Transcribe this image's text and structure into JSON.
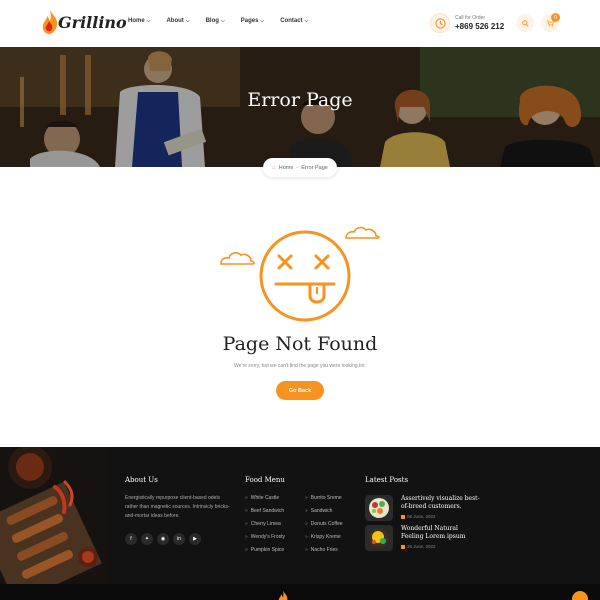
{
  "brand": {
    "name": "Grillino",
    "accent": "#f7931e"
  },
  "nav": [
    {
      "label": "Home"
    },
    {
      "label": "About"
    },
    {
      "label": "Blog"
    },
    {
      "label": "Pages"
    },
    {
      "label": "Contact"
    }
  ],
  "call": {
    "label": "Call for Order",
    "number": "+869 526 212"
  },
  "cart": {
    "count": "0"
  },
  "hero": {
    "title": "Error Page"
  },
  "breadcrumb": {
    "home": "Home",
    "current": "Error Page"
  },
  "error": {
    "title": "Page Not Found",
    "message": "We're sorry, but we can't find the page you were looking for.",
    "button": "Go Back"
  },
  "footer": {
    "about": {
      "title": "About Us",
      "text": "Energistically repurpose client-based odels rather than magnetic sources. Intrinsicly bricks-and-mortar ideas before."
    },
    "social_icons": [
      "facebook-icon",
      "twitter-icon",
      "instagram-icon",
      "linkedin-icon",
      "youtube-icon"
    ],
    "menu": {
      "title": "Food Menu",
      "col1": [
        "White Castle",
        "Beef Sandwich",
        "Cherry Limea",
        "Wendy's Frosty",
        "Pumpkin Spice"
      ],
      "col2": [
        "Burrito Sreme",
        "Sandwich",
        "Donuts Coffee",
        "Krispy Kreme",
        "Nacho Fries"
      ]
    },
    "posts": {
      "title": "Latest Posts",
      "items": [
        {
          "title": "Assertively visualize best-of-breed customers.",
          "date": "08 June, 2022"
        },
        {
          "title": "Wonderful Natural Feeling Lorem ipsum",
          "date": "26 June, 2022"
        }
      ]
    }
  }
}
